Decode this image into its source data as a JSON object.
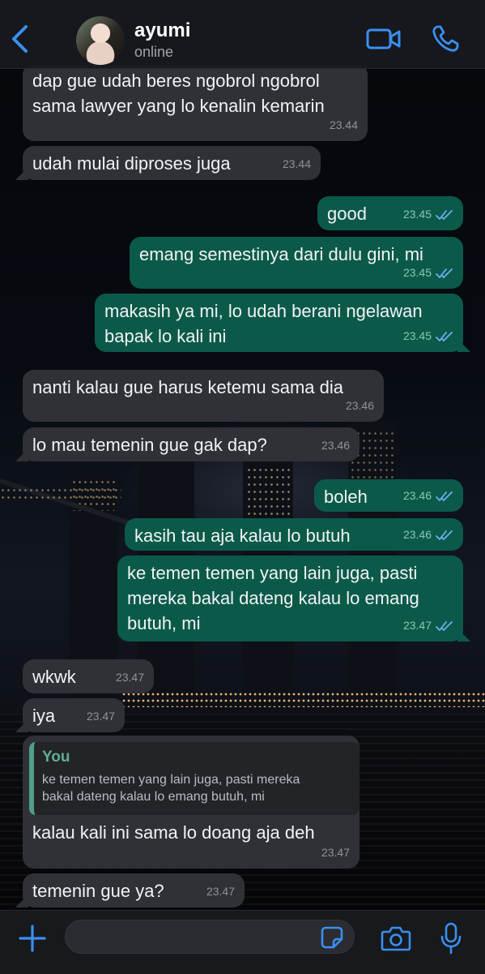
{
  "contact": {
    "name": "ayumi",
    "status": "online"
  },
  "colors": {
    "accent": "#3a8ff0",
    "incoming": "#2f3136",
    "outgoing": "#0b5a49",
    "quote_bar": "#4f9f86"
  },
  "icons": {
    "back": "chevron-left-icon",
    "video": "video-call-icon",
    "call": "phone-icon",
    "attach": "plus-icon",
    "sticker": "sticker-icon",
    "camera": "camera-icon",
    "mic": "microphone-icon",
    "read": "double-check-icon"
  },
  "messages": [
    {
      "dir": "in",
      "text": "dap gue udah beres ngobrol ngobrol\nsama lawyer yang lo kenalin kemarin",
      "time": "23.44"
    },
    {
      "dir": "in",
      "text": "udah mulai diproses juga",
      "time": "23.44"
    },
    {
      "dir": "out",
      "text": "good",
      "time": "23.45"
    },
    {
      "dir": "out",
      "text": "emang semestinya dari dulu gini, mi",
      "time": "23.45"
    },
    {
      "dir": "out",
      "text": "makasih ya mi, lo udah berani ngelawan\nbapak lo kali ini",
      "time": "23.45"
    },
    {
      "dir": "in",
      "text": "nanti kalau gue harus ketemu sama dia",
      "time": "23.46"
    },
    {
      "dir": "in",
      "text": "lo mau temenin gue gak dap?",
      "time": "23.46"
    },
    {
      "dir": "out",
      "text": "boleh",
      "time": "23.46"
    },
    {
      "dir": "out",
      "text": "kasih tau aja kalau lo butuh",
      "time": "23.46"
    },
    {
      "dir": "out",
      "text": "ke temen temen yang lain juga, pasti\nmereka bakal dateng kalau lo emang\nbutuh, mi",
      "time": "23.47"
    },
    {
      "dir": "in",
      "text": "wkwk",
      "time": "23.47"
    },
    {
      "dir": "in",
      "text": "iya",
      "time": "23.47"
    },
    {
      "dir": "in",
      "text": "kalau kali ini sama lo doang aja deh",
      "time": "23.47",
      "reply": {
        "from": "You",
        "text": "ke temen temen yang lain juga, pasti mereka\nbakal dateng kalau lo emang butuh, mi"
      }
    },
    {
      "dir": "in",
      "text": "temenin gue ya?",
      "time": "23.47"
    }
  ],
  "composer": {
    "placeholder": ""
  }
}
